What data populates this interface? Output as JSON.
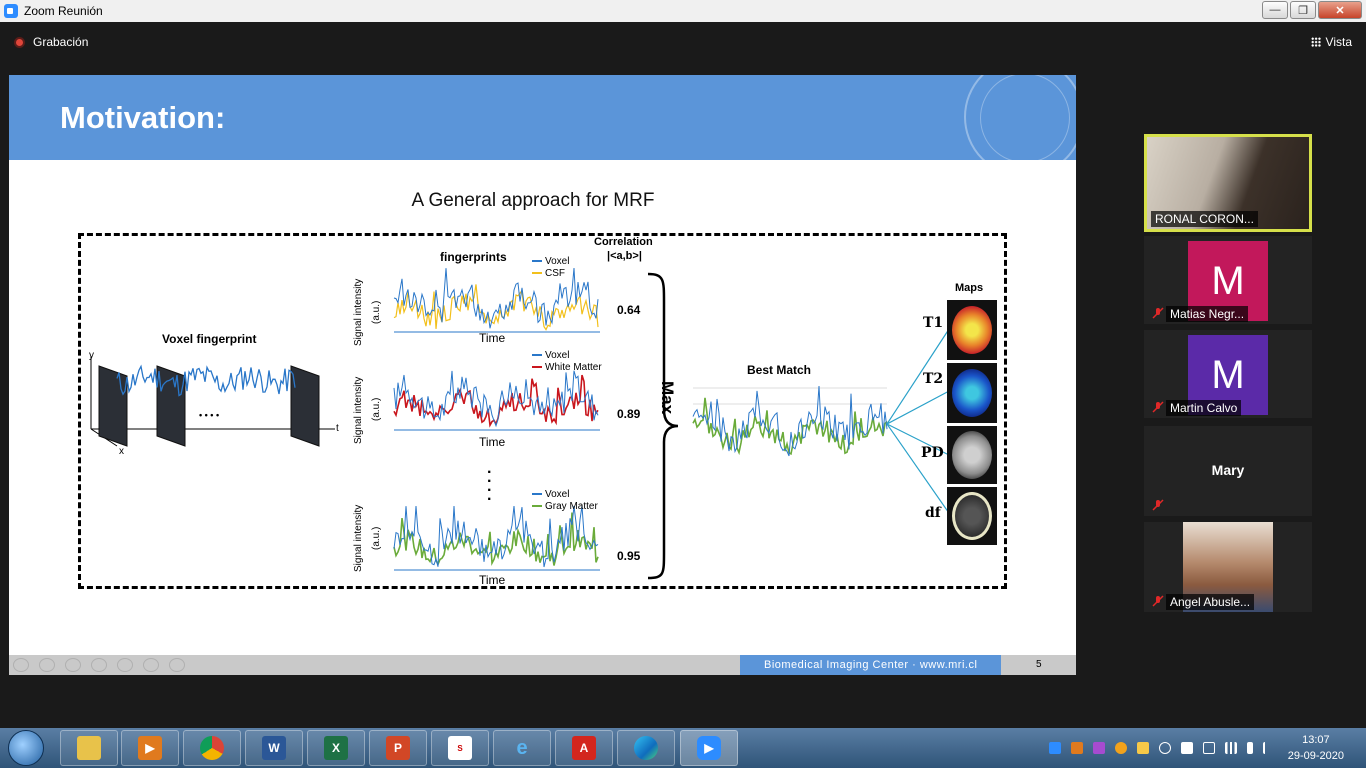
{
  "window": {
    "title": "Zoom Reunión",
    "minimize": "—",
    "maximize": "❐",
    "close": "✕"
  },
  "zoom": {
    "recording_label": "Grabación",
    "view_label": "Vista"
  },
  "slide": {
    "title": "Motivation:",
    "subtitle": "A General approach for MRF",
    "footer_text": "Biomedical Imaging Center · www.mri.cl",
    "page_number": "5",
    "figure": {
      "voxel_fingerprint": "Voxel fingerprint",
      "fingerprints": "fingerprints",
      "correlation": "Correlation",
      "correlation_formula": "|<a,b>|",
      "ylabel": "Signal intensity",
      "yunit": "(a.u.)",
      "xlabel": "Time",
      "legend_voxel": "Voxel",
      "legend_csf": "CSF",
      "legend_wm": "White Matter",
      "legend_gm": "Gray Matter",
      "corr_values": [
        "0.64",
        "0.89",
        "0.95"
      ],
      "max_label": "Max",
      "best_match": "Best Match",
      "maps": "Maps",
      "map_labels": [
        "T1",
        "T2",
        "PD",
        "df"
      ],
      "axis_y": "y",
      "axis_x": "x",
      "axis_t": "t",
      "dots": "• • • •",
      "colors": {
        "voxel": "#2a77c9",
        "csf": "#f2c01c",
        "wm": "#c9161d",
        "gm": "#6aab3a"
      }
    }
  },
  "participants": [
    {
      "name": "RONAL CORON..."
    },
    {
      "name": "Matias Negr...",
      "initial": "M",
      "color": "#c2185b"
    },
    {
      "name": "Martin Calvo",
      "initial": "M",
      "color": "#5b2aa8"
    },
    {
      "name": "Mary"
    },
    {
      "name": "Angel Abusle..."
    }
  ],
  "taskbar": {
    "time": "13:07",
    "date": "29-09-2020"
  }
}
